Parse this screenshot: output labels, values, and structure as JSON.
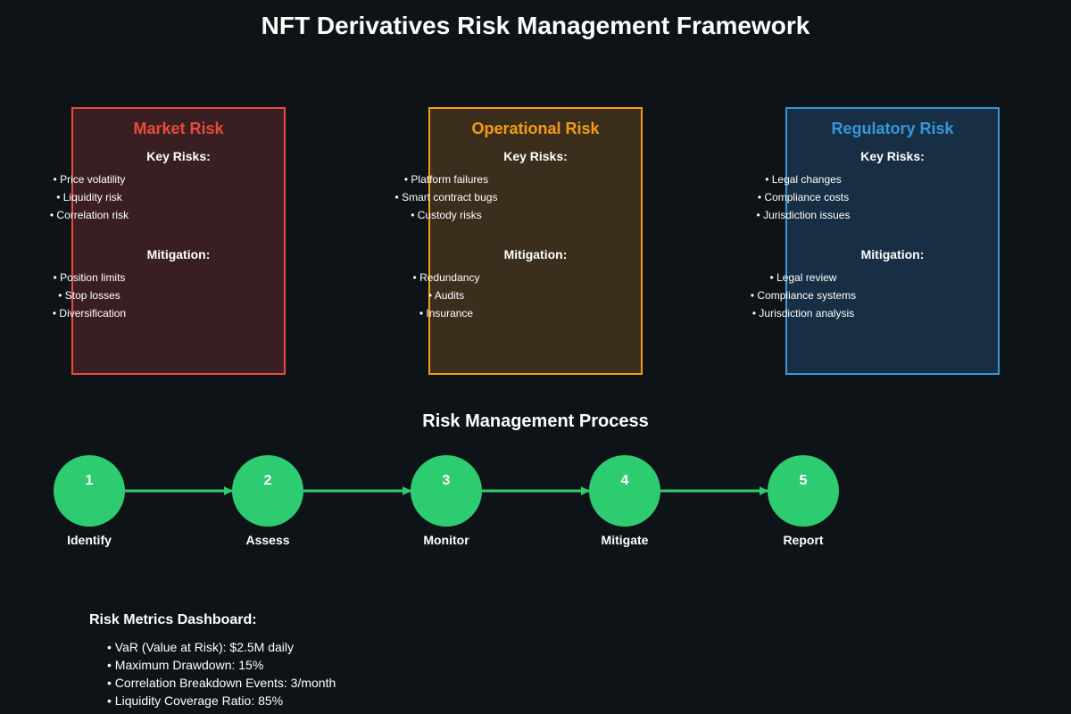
{
  "title": "NFT Derivatives Risk Management Framework",
  "risk_categories": [
    {
      "title": "Market Risk",
      "color": "#e74c3c",
      "fill": "#3a1f22",
      "key_risks_heading": "Key Risks:",
      "key_risks": [
        "• Price volatility",
        "• Liquidity risk",
        "• Correlation risk"
      ],
      "mitigation_heading": "Mitigation:",
      "mitigation": [
        "• Position limits",
        "• Stop losses",
        "• Diversification"
      ]
    },
    {
      "title": "Operational Risk",
      "color": "#f39c12",
      "fill": "#3b2e1c",
      "key_risks_heading": "Key Risks:",
      "key_risks": [
        "• Platform failures",
        "• Smart contract bugs",
        "• Custody risks"
      ],
      "mitigation_heading": "Mitigation:",
      "mitigation": [
        "• Redundancy",
        "• Audits",
        "• Insurance"
      ]
    },
    {
      "title": "Regulatory Risk",
      "color": "#3498db",
      "fill": "#182e44",
      "key_risks_heading": "Key Risks:",
      "key_risks": [
        "• Legal changes",
        "• Compliance costs",
        "• Jurisdiction issues"
      ],
      "mitigation_heading": "Mitigation:",
      "mitigation": [
        "• Legal review",
        "• Compliance systems",
        "• Jurisdiction analysis"
      ]
    }
  ],
  "process": {
    "title": "Risk Management Process",
    "color": "#2ecc71",
    "steps": [
      {
        "number": "1",
        "label": "Identify"
      },
      {
        "number": "2",
        "label": "Assess"
      },
      {
        "number": "3",
        "label": "Monitor"
      },
      {
        "number": "4",
        "label": "Mitigate"
      },
      {
        "number": "5",
        "label": "Report"
      }
    ]
  },
  "metrics": {
    "title": "Risk Metrics Dashboard:",
    "items": [
      "• VaR (Value at Risk): $2.5M daily",
      "• Maximum Drawdown: 15%",
      "• Correlation Breakdown Events: 3/month",
      "• Liquidity Coverage Ratio: 85%"
    ]
  }
}
